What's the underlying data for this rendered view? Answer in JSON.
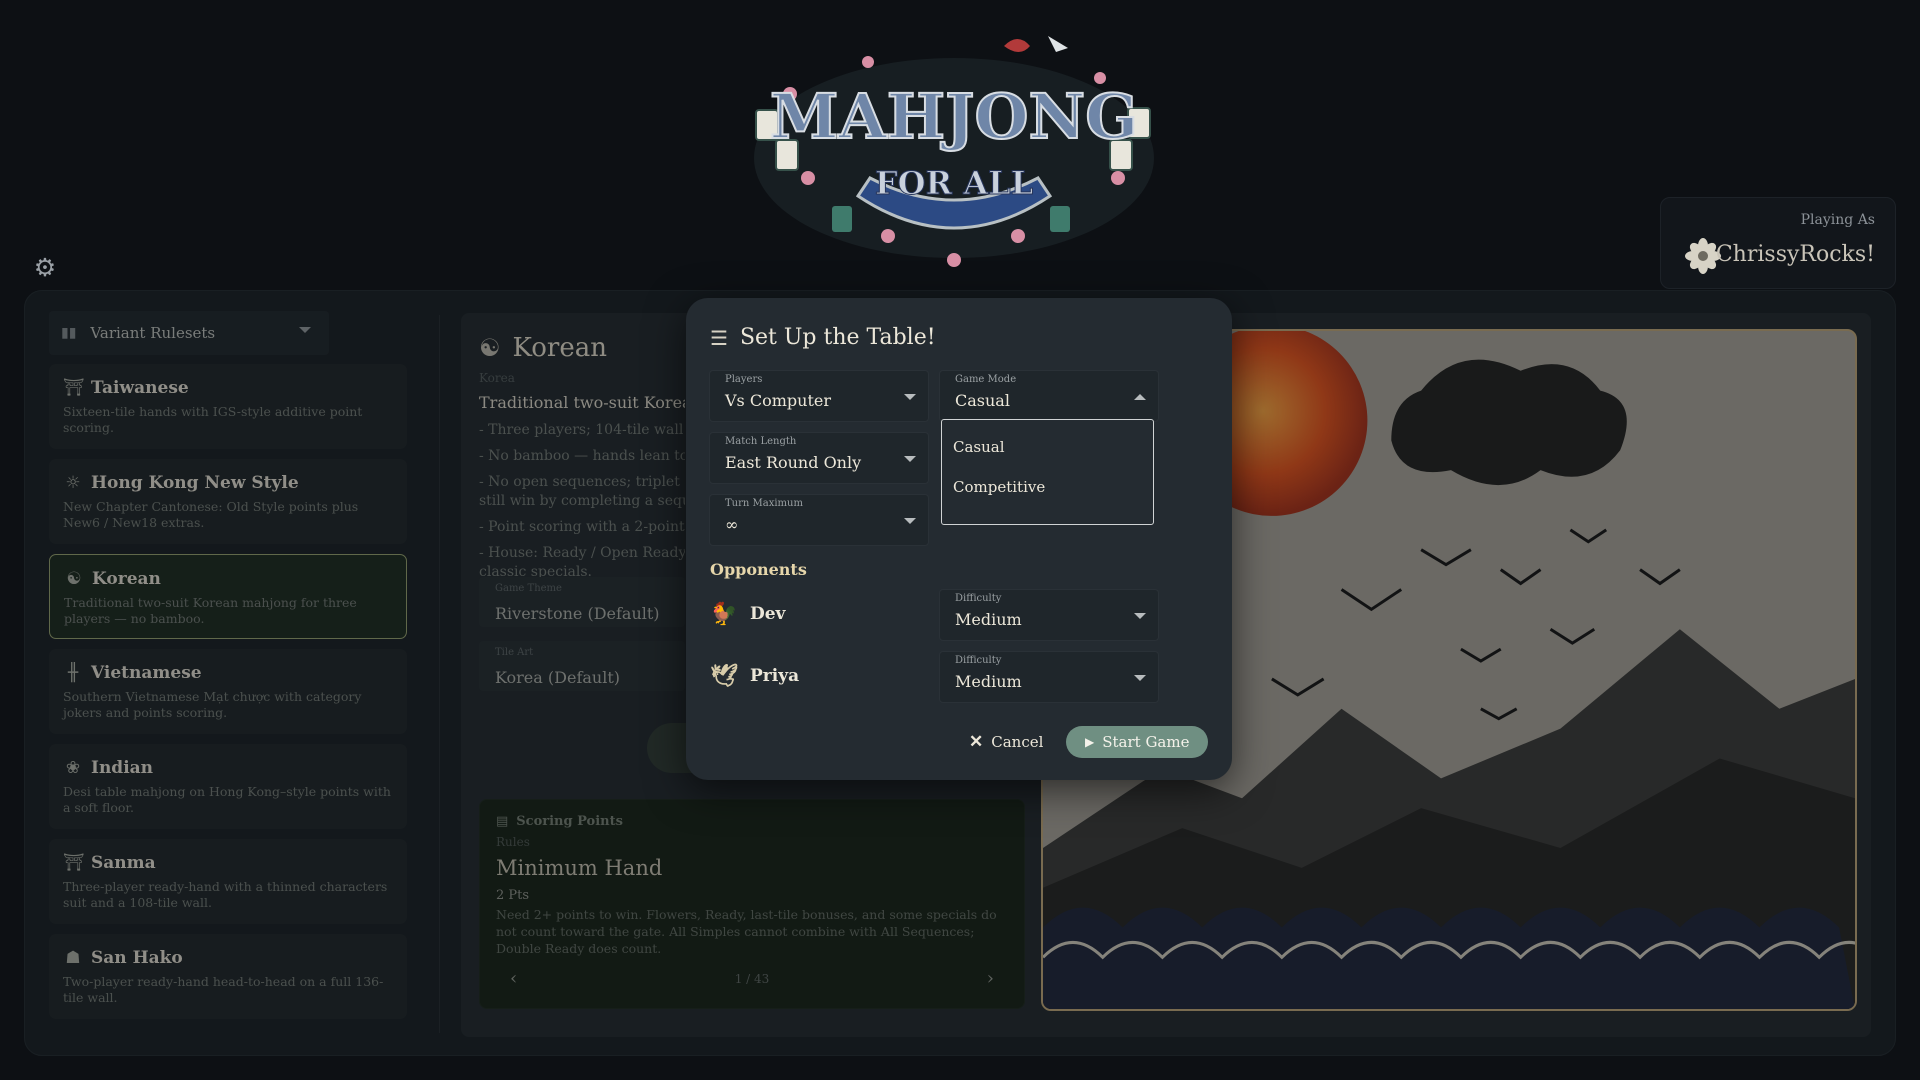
{
  "logo": {
    "line1": "MAHJONG",
    "line2": "FOR ALL"
  },
  "header": {
    "settings_icon": "gear-icon",
    "playing_as_label": "Playing As",
    "player_name": "ChrissyRocks!",
    "player_avatar_icon": "flower-icon"
  },
  "sidebar": {
    "select_label": "Variant Rulesets",
    "items": [
      {
        "name": "Taiwanese",
        "desc": "Sixteen-tile hands with IGS-style additive point scoring.",
        "icon": "pagoda-icon",
        "glyph": "⛩"
      },
      {
        "name": "Hong Kong New Style",
        "desc": "New Chapter Cantonese: Old Style points plus New6 / New18 extras.",
        "icon": "sun-icon",
        "glyph": "☼"
      },
      {
        "name": "Korean",
        "desc": "Traditional two-suit Korean mahjong for three players — no bamboo.",
        "icon": "taegeuk-icon",
        "glyph": "☯",
        "selected": true
      },
      {
        "name": "Vietnamese",
        "desc": "Southern Vietnamese Mạt chược with category jokers and points scoring.",
        "icon": "bamboo-icon",
        "glyph": "╫"
      },
      {
        "name": "Indian",
        "desc": "Desi table mahjong on Hong Kong–style points with a soft floor.",
        "icon": "lotus-icon",
        "glyph": "❀"
      },
      {
        "name": "Sanma",
        "desc": "Three-player ready-hand with a thinned characters suit and a 108-tile wall.",
        "icon": "torii-icon",
        "glyph": "⛩"
      },
      {
        "name": "San Hako",
        "desc": "Two-player ready-hand head-to-head on a full 136-tile wall.",
        "icon": "crest-icon",
        "glyph": "☗"
      }
    ]
  },
  "detail": {
    "title": "Korean",
    "subtitle": "Korea",
    "lead": "Traditional two-suit Korean m",
    "rules": [
      "- Three players; 104-tile wall (ch",
      "- No bamboo — hands lean towa",
      "- No open sequences; triplet anc",
      "still win by completing a sequer",
      "- Point scoring with a 2-point m",
      "- House: Ready / Open Ready, De",
      "classic specials."
    ],
    "game_theme_label": "Game Theme",
    "game_theme_value": "Riverstone (Default)",
    "tile_art_label": "Tile Art",
    "tile_art_value": "Korea (Default)"
  },
  "scoring": {
    "header": "Scoring Points",
    "subheader": "Rules",
    "title": "Minimum Hand",
    "points": "2 Pts",
    "text": "Need 2+ points to win. Flowers, Ready, last-tile bonuses, and some specials do not count toward the gate. All Simples cannot combine with All Sequences; Double Ready does count.",
    "page": "1 / 43"
  },
  "modal": {
    "title": "Set Up the Table!",
    "players_label": "Players",
    "players_value": "Vs Computer",
    "game_mode_label": "Game Mode",
    "game_mode_value": "Casual",
    "match_length_label": "Match Length",
    "match_length_value": "East Round Only",
    "turn_max_label": "Turn Maximum",
    "turn_max_value": "∞",
    "mode_options": [
      "Casual",
      "Competitive"
    ],
    "opponents_label": "Opponents",
    "opponents": [
      {
        "name": "Dev",
        "difficulty_label": "Difficulty",
        "difficulty": "Medium",
        "icon": "chicken-icon"
      },
      {
        "name": "Priya",
        "difficulty_label": "Difficulty",
        "difficulty": "Medium",
        "icon": "bird-icon"
      }
    ],
    "cancel_label": "Cancel",
    "start_label": "Start Game"
  },
  "colors": {
    "accent": "#6f8f82",
    "selected_border": "#8f9a6a",
    "heading_gold": "#e6d6aa",
    "background": "#0d1014"
  }
}
